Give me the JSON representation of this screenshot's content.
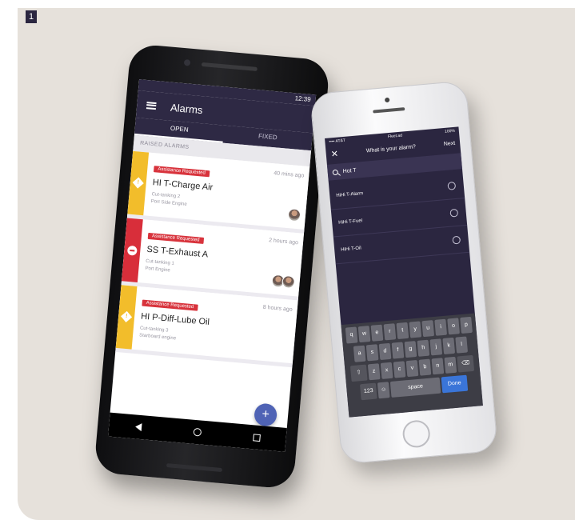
{
  "figure": {
    "number": "1"
  },
  "android": {
    "status_time": "12:39",
    "app_title": "Alarms",
    "tabs": [
      {
        "label": "OPEN"
      },
      {
        "label": "FIXED"
      }
    ],
    "section_label": "RAISED ALARMS",
    "alarms": [
      {
        "badge": "Assistance Requested",
        "time": "40 mins ago",
        "name": "HI T-Charge Air",
        "meta1": "Cut-tanking 2",
        "meta2": "Port Side Engine",
        "color": "#f2bd2b",
        "icon": "warning-diamond-icon",
        "avatars": 1
      },
      {
        "badge": "Assistance Requested",
        "time": "2 hours ago",
        "name": "SS T-Exhaust A",
        "meta1": "Cut-tanking 1",
        "meta2": "Port Engine",
        "color": "#d82e3a",
        "icon": "stop-icon",
        "avatars": 2
      },
      {
        "badge": "Assistance Requested",
        "time": "8 hours ago",
        "name": "HI P-Diff-Lube Oil",
        "meta1": "Cut-tanking 3",
        "meta2": "Starboard engine",
        "color": "#f2bd2b",
        "icon": "warning-diamond-icon",
        "avatars": 0
      }
    ],
    "fab_label": "+"
  },
  "iphone": {
    "status_left": "•••• AT&T",
    "status_center": "Fleet.ad",
    "status_right": "100%",
    "header_title": "What is your alarm?",
    "header_action": "Next",
    "search_value": "Hot T",
    "results": [
      {
        "label": "HiHi T-Alarm"
      },
      {
        "label": "HiHi T-Fuel"
      },
      {
        "label": "HiHi T-Oil"
      }
    ],
    "keyboard": {
      "row1": [
        "q",
        "w",
        "e",
        "r",
        "t",
        "y",
        "u",
        "i",
        "o",
        "p"
      ],
      "row2": [
        "a",
        "s",
        "d",
        "f",
        "g",
        "h",
        "j",
        "k",
        "l"
      ],
      "row3": [
        "⇧",
        "z",
        "x",
        "c",
        "v",
        "b",
        "n",
        "m",
        "⌫"
      ],
      "space_label": "space",
      "done_label": "Done",
      "num_label": "123"
    }
  },
  "colors": {
    "navy": "#2e2944",
    "red": "#d82e3a",
    "yellow": "#f2bd2b",
    "fab_blue": "#4f63b5"
  }
}
